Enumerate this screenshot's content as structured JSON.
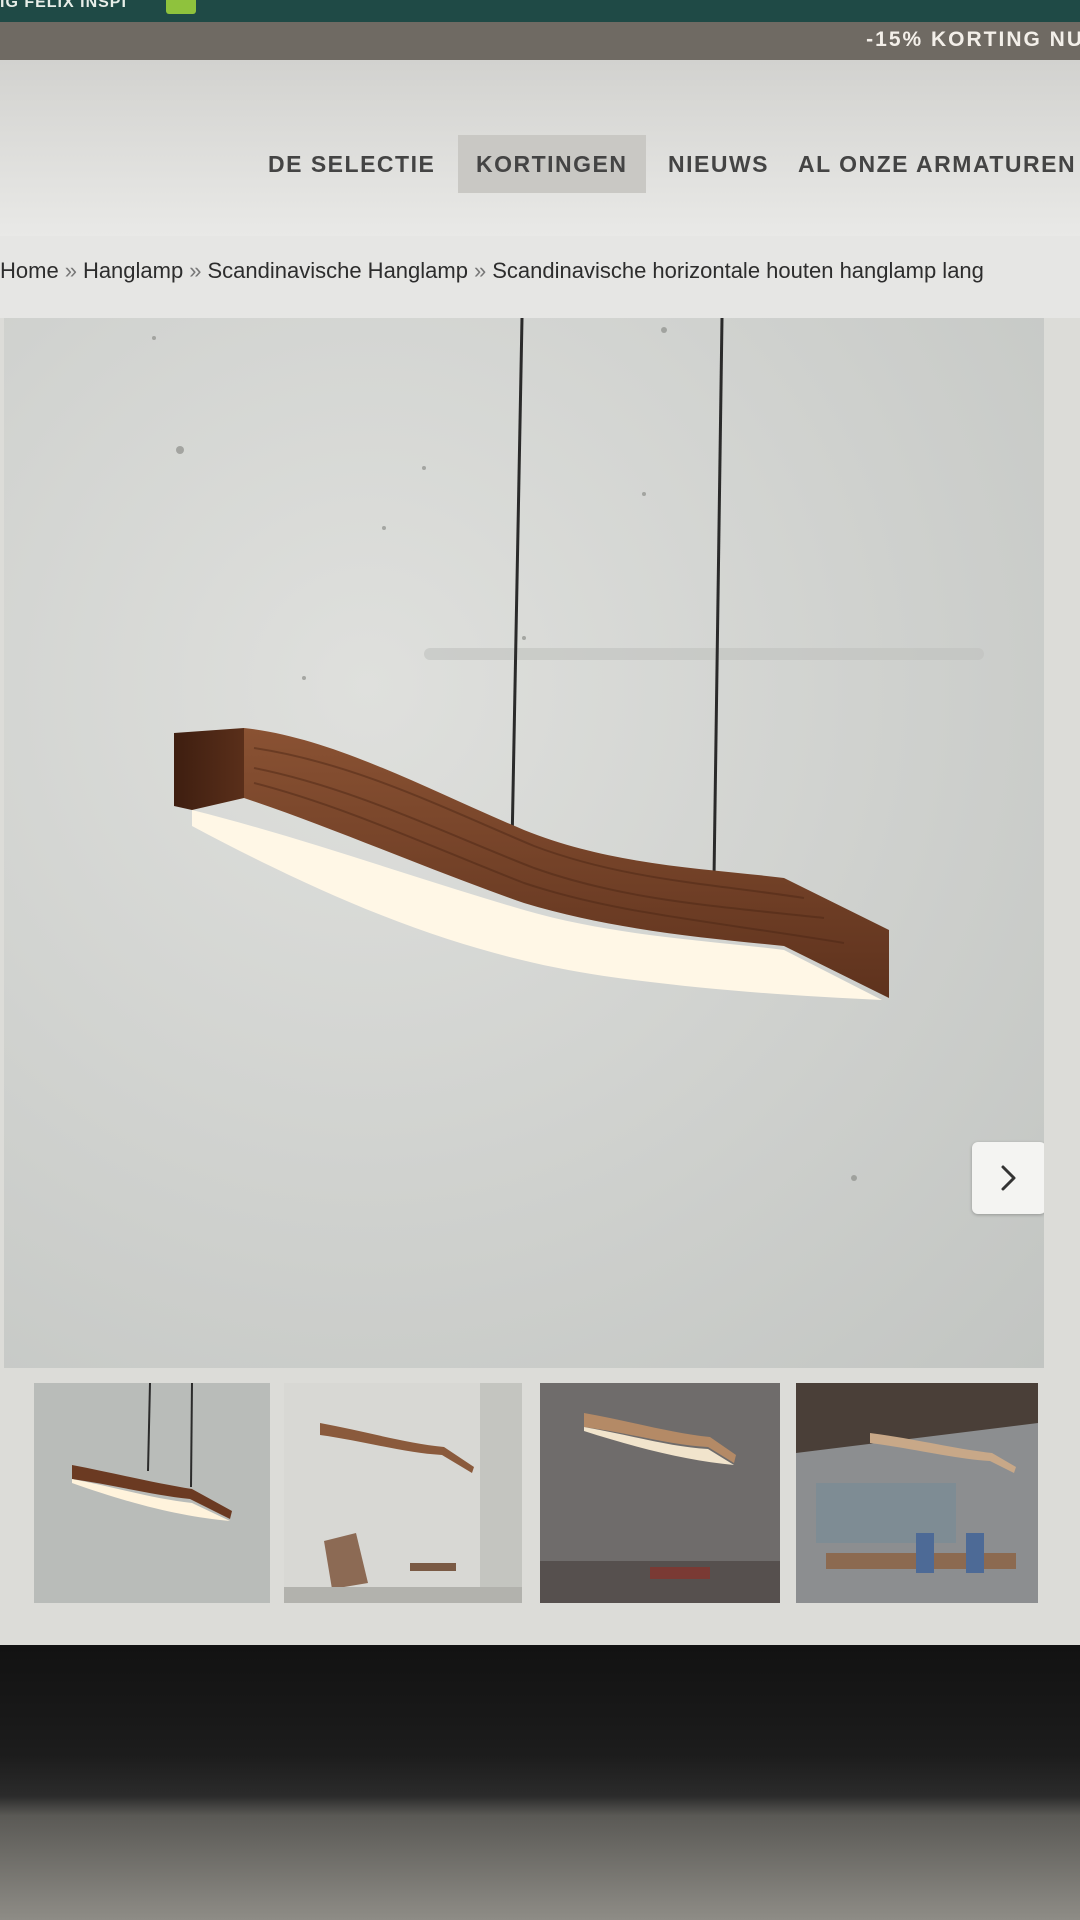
{
  "topbar": {
    "text_left": "IG FELIX INSPI"
  },
  "promo": {
    "text": "-15% KORTING NU"
  },
  "nav": {
    "items": [
      {
        "label": "DE SELECTIE",
        "active": false
      },
      {
        "label": "KORTINGEN",
        "active": true
      },
      {
        "label": "NIEUWS",
        "active": false
      },
      {
        "label": "AL ONZE ARMATUREN",
        "active": false
      }
    ]
  },
  "breadcrumb": {
    "separator": "»",
    "items": [
      "Home",
      "Hanglamp",
      "Scandinavische Hanglamp",
      "Scandinavische horizontale houten hanglamp lang"
    ]
  },
  "gallery": {
    "main_image": "wooden-wave-pendant-lamp",
    "next_icon": "chevron-right-icon",
    "thumbnails": [
      {
        "name": "thumb-lamp-grey-background"
      },
      {
        "name": "thumb-lamp-living-room"
      },
      {
        "name": "thumb-lamp-dark-room"
      },
      {
        "name": "thumb-lamp-dining-room"
      }
    ]
  },
  "colors": {
    "topbar": "#1f4a46",
    "promo_bar": "#6f6a63",
    "nav_active_bg": "#c9c8c4",
    "wood": "#6b3a22"
  }
}
